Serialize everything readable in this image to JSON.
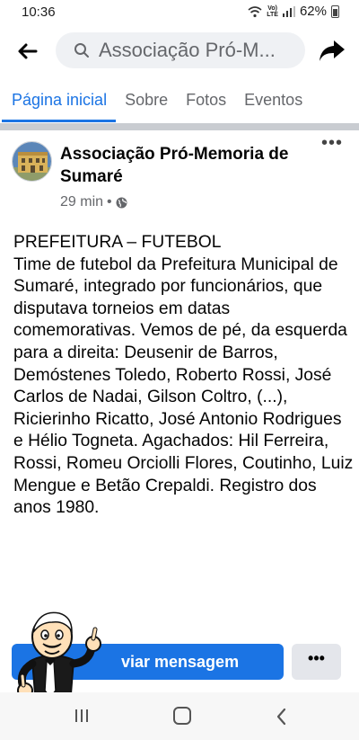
{
  "status_bar": {
    "time": "10:36",
    "network_top": "Vo)",
    "network_bottom": "LTE",
    "battery": "62%"
  },
  "top_bar": {
    "search_text": "Associação Pró-M..."
  },
  "tabs": [
    {
      "label": "Página inicial",
      "active": true
    },
    {
      "label": "Sobre",
      "active": false
    },
    {
      "label": "Fotos",
      "active": false
    },
    {
      "label": "Eventos",
      "active": false
    }
  ],
  "post": {
    "author": "Associação Pró-Memoria de Sumaré",
    "time": "29 min",
    "separator": "•",
    "privacy_icon": "globe-icon",
    "more_label": "•••",
    "text": "PREFEITURA – FUTEBOL\nTime de futebol da Prefeitura Municipal de Sumaré, integrado por funcionários, que disputava torneios em datas comemorativas. Vemos de pé, da esquerda para a direita: Deusenir de Barros, Demóstenes Toledo, Roberto Rossi, José Carlos de Nadai, Gilson Coltro, (...), Ricierinho Ricatto, José Antonio Rodrigues e Hélio Togneta. Agachados: Hil Ferreira, Rossi, Romeu Orciolli Flores, Coutinho, Luiz Mengue e Betão Crepaldi. Registro dos anos 1980."
  },
  "actions": {
    "send_message_label": "viar mensagem",
    "more_label": "•••"
  },
  "colors": {
    "accent": "#1b74e4",
    "muted": "#65676b"
  }
}
